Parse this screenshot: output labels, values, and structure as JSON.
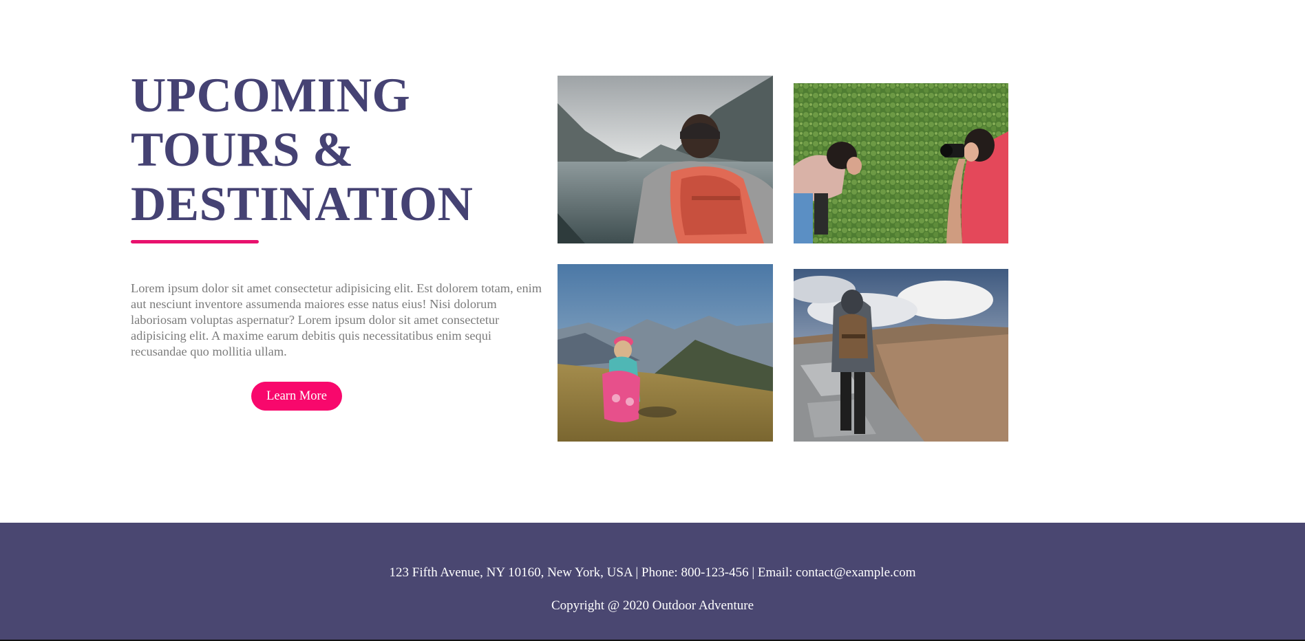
{
  "intro": {
    "headline_lines": [
      "UPCOMING",
      "TOURS &",
      "DESTINATION"
    ],
    "body": "Lorem ipsum dolor sit amet consectetur adipisicing elit. Est dolorem totam, enim aut nesciunt inventore assumenda maiores esse natus eius! Nisi dolorum laboriosam voluptas aspernatur? Lorem ipsum dolor sit amet consectetur adipisicing elit. A maxime earum debitis quis necessitatibus enim sequi recusandae quo mollitia ullam.",
    "button_label": "Learn More"
  },
  "gallery": {
    "photos": [
      {
        "icon": "lake-hiker-photo"
      },
      {
        "icon": "photographers-on-grass-photo"
      },
      {
        "icon": "girl-on-mountain-meadow-photo"
      },
      {
        "icon": "hiker-on-rocky-trail-photo"
      }
    ]
  },
  "footer": {
    "contact": "123 Fifth Avenue, NY 10160, New York, USA | Phone: 800-123-456 | Email: contact@example.com",
    "copyright": "Copyright @ 2020 Outdoor Adventure"
  },
  "colors": {
    "heading": "#454273",
    "accent": "#f8086c",
    "underline": "#e8116d",
    "body_text": "#7b7b7b",
    "footer_bg": "#4a4771",
    "footer_text": "#ffffff"
  }
}
